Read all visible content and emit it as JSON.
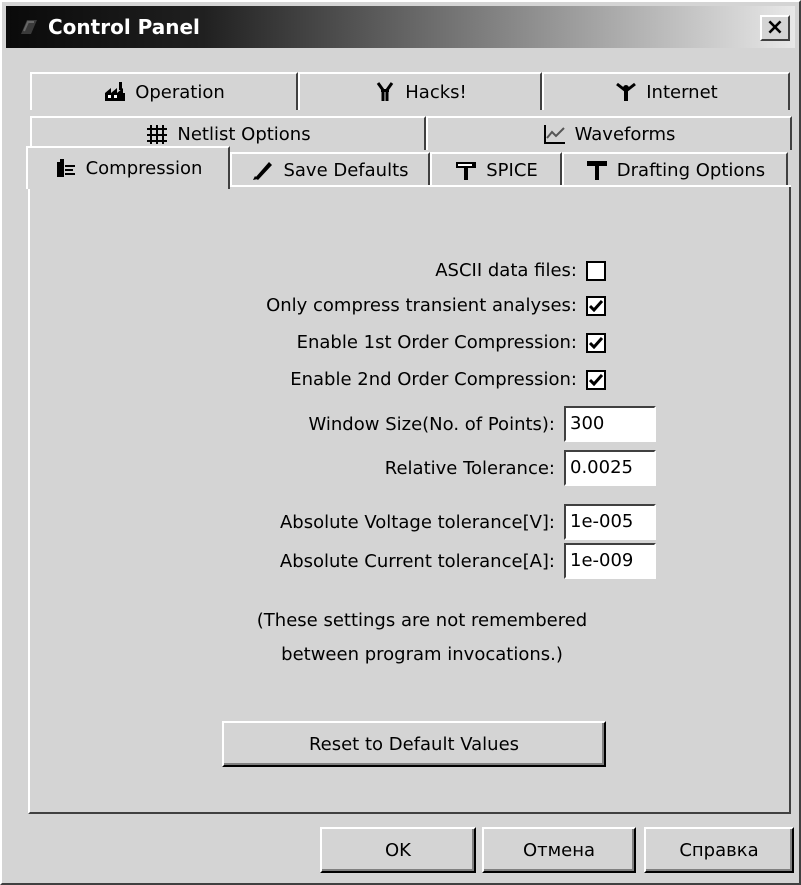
{
  "window": {
    "title": "Control Panel",
    "close_label": "×"
  },
  "tabs": {
    "row1": [
      {
        "label": "Operation",
        "icon": "factory-icon"
      },
      {
        "label": "Hacks!",
        "icon": "pliers-icon"
      },
      {
        "label": "Internet",
        "icon": "antenna-icon"
      }
    ],
    "row2": [
      {
        "label": "Netlist Options",
        "icon": "grid-icon"
      },
      {
        "label": "Waveforms",
        "icon": "waveform-icon"
      }
    ],
    "row3": [
      {
        "label": "Compression",
        "icon": "compress-icon",
        "active": true
      },
      {
        "label": "Save Defaults",
        "icon": "pen-icon"
      },
      {
        "label": "SPICE",
        "icon": "hammer-icon"
      },
      {
        "label": "Drafting Options",
        "icon": "tsquare-icon"
      }
    ]
  },
  "compression": {
    "ascii": {
      "label": "ASCII data files:",
      "checked": false
    },
    "only_transient": {
      "label": "Only compress transient analyses:",
      "checked": true
    },
    "first_order": {
      "label": "Enable 1st Order Compression:",
      "checked": true
    },
    "second_order": {
      "label": "Enable 2nd Order Compression:",
      "checked": true
    },
    "window_size": {
      "label": "Window Size(No. of Points):",
      "value": "300"
    },
    "rel_tol": {
      "label": "Relative Tolerance:",
      "value": "0.0025"
    },
    "abs_volt": {
      "label": "Absolute Voltage tolerance[V]:",
      "value": "1e-005"
    },
    "abs_curr": {
      "label": "Absolute Current tolerance[A]:",
      "value": "1e-009"
    },
    "note_line1": "(These settings are not remembered",
    "note_line2": "between program invocations.)",
    "reset_label": "Reset to Default Values"
  },
  "footer": {
    "ok_label": "OK",
    "cancel_label": "Отмена",
    "help_label": "Справка"
  }
}
